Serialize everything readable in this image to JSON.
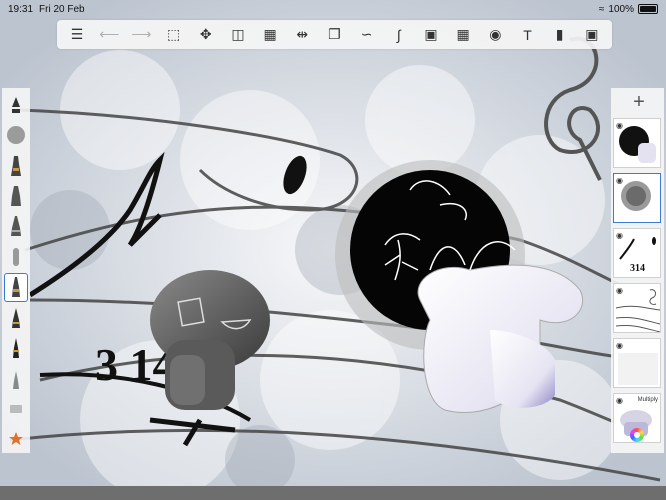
{
  "status": {
    "time": "19:31",
    "date": "Fri 20 Feb",
    "battery": "100%"
  },
  "toolbar": {
    "icons": [
      "list-icon",
      "undo-icon",
      "redo-icon",
      "selection-icon",
      "transform-icon",
      "bucket-icon",
      "eraser-icon",
      "symmetry-icon",
      "shapes-icon",
      "ruler-curve-icon",
      "stroke-icon",
      "image-icon",
      "perspective-icon",
      "reference-icon",
      "text-icon",
      "record-icon",
      "canvas-icon"
    ],
    "text_tool_label": "T"
  },
  "brushes": {
    "icons": [
      "brush-nib-a-icon",
      "brush-round-icon",
      "brush-pen-b-icon",
      "brush-pen-c-icon",
      "brush-pen-d-icon",
      "brush-airbrush-icon",
      "brush-pen-e-icon",
      "brush-pen-f-icon",
      "brush-pen-g-icon",
      "brush-pen-h-icon",
      "brush-tablet-icon",
      "favorites-star-icon"
    ],
    "selected_index": 6
  },
  "layers": {
    "add_label": "+",
    "blend_mode": "Multiply",
    "items": [
      "layer-1",
      "layer-2",
      "layer-3",
      "layer-4",
      "layer-5",
      "layer-6"
    ],
    "selected_index": 1
  },
  "canvas": {
    "text": "3 14"
  }
}
